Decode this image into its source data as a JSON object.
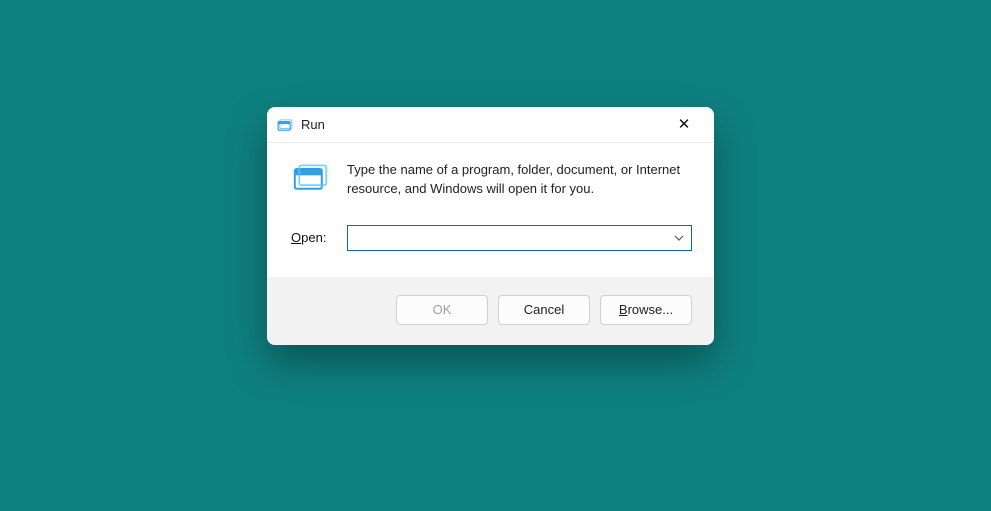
{
  "dialog": {
    "title": "Run",
    "description": "Type the name of a program, folder, document, or Internet resource, and Windows will open it for you.",
    "open_label_prefix": "O",
    "open_label_rest": "pen:",
    "input_value": "",
    "buttons": {
      "ok": "OK",
      "cancel": "Cancel",
      "browse_prefix": "B",
      "browse_rest": "rowse..."
    }
  }
}
